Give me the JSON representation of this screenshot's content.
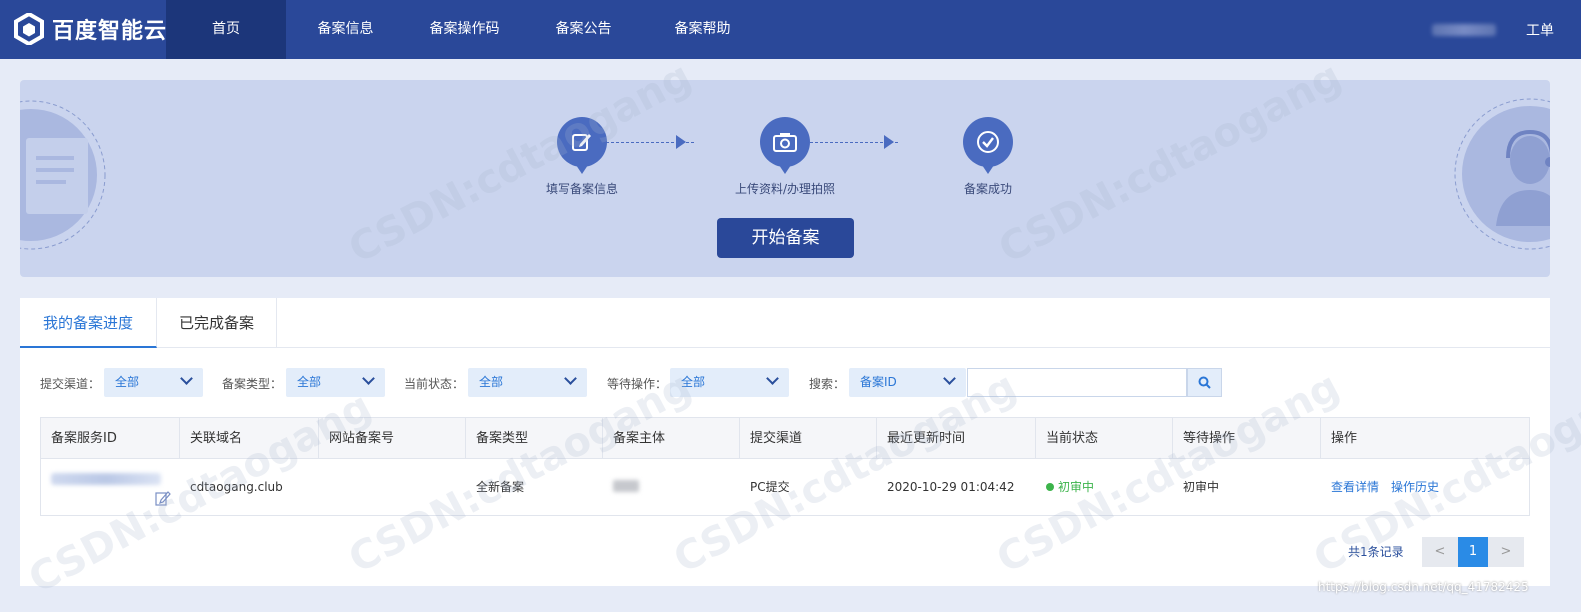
{
  "brand": {
    "name": "百度智能云"
  },
  "nav": {
    "items": [
      {
        "label": "首页",
        "active": true
      },
      {
        "label": "备案信息",
        "active": false
      },
      {
        "label": "备案操作码",
        "active": false
      },
      {
        "label": "备案公告",
        "active": false
      },
      {
        "label": "备案帮助",
        "active": false
      }
    ],
    "ticket": "工单"
  },
  "banner": {
    "steps": [
      {
        "label": "填写备案信息",
        "icon": "edit-icon"
      },
      {
        "label": "上传资料/办理拍照",
        "icon": "camera-icon"
      },
      {
        "label": "备案成功",
        "icon": "check-icon"
      }
    ],
    "start_button": "开始备案"
  },
  "tabs": [
    {
      "label": "我的备案进度",
      "active": true
    },
    {
      "label": "已完成备案",
      "active": false
    }
  ],
  "filters": {
    "channel": {
      "label": "提交渠道：",
      "value": "全部"
    },
    "type": {
      "label": "备案类型：",
      "value": "全部"
    },
    "status": {
      "label": "当前状态：",
      "value": "全部"
    },
    "pending": {
      "label": "等待操作：",
      "value": "全部"
    },
    "search": {
      "label": "搜索：",
      "field": "备案ID",
      "value": "",
      "placeholder": ""
    }
  },
  "table": {
    "columns": [
      "备案服务ID",
      "关联域名",
      "网站备案号",
      "备案类型",
      "备案主体",
      "提交渠道",
      "最近更新时间",
      "当前状态",
      "等待操作",
      "操作"
    ],
    "rows": [
      {
        "domain": "cdtaogang.club",
        "record_no": "",
        "type": "全新备案",
        "channel": "PC提交",
        "updated": "2020-10-29 01:04:42",
        "status": "初审中",
        "pending": "初审中",
        "actions": [
          "查看详情",
          "操作历史"
        ]
      }
    ]
  },
  "pagination": {
    "total_label": "共1条记录",
    "prev": "<",
    "current": "1",
    "next": ">"
  },
  "watermark": {
    "text": "CSDN:cdtaogang",
    "url": "https://blog.csdn.net/qq_41782425"
  },
  "colors": {
    "topbar": "#2a4899",
    "accent": "#2a76d6",
    "status": "#3cb44b",
    "banner": "#cad4ee"
  }
}
